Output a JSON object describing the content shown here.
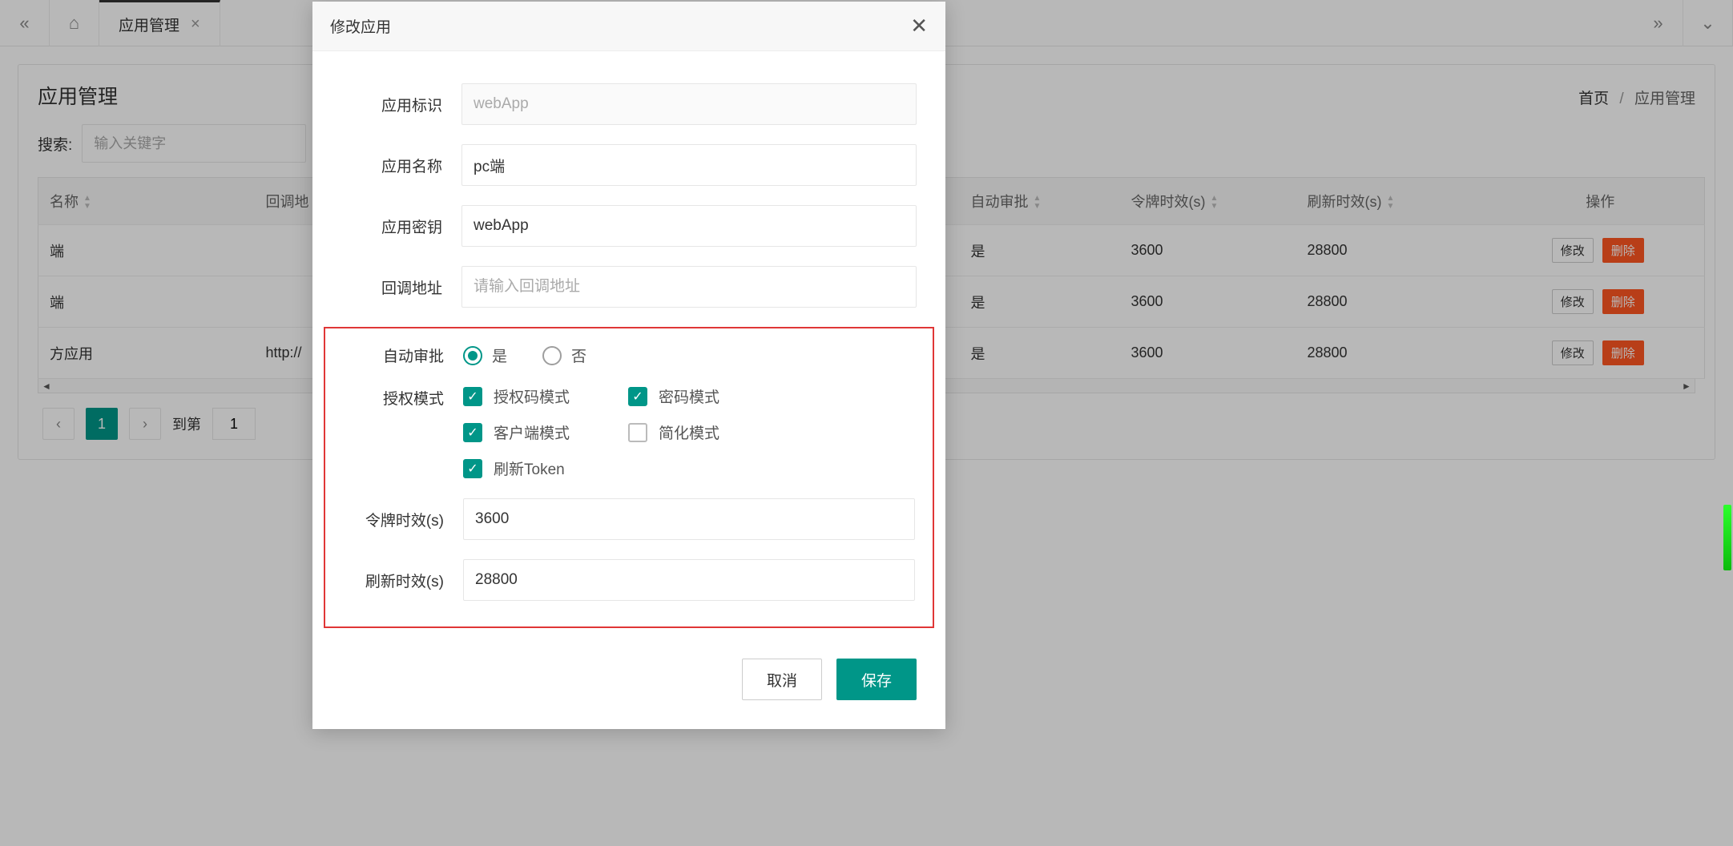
{
  "topbar": {
    "tab_label": "应用管理"
  },
  "page": {
    "title": "应用管理",
    "breadcrumb_home": "首页",
    "breadcrumb_current": "应用管理",
    "search_label": "搜索:",
    "search_placeholder": "输入关键字"
  },
  "table": {
    "headers": {
      "name": "名称",
      "callback": "回调地",
      "auto_approve": "自动审批",
      "token_ttl": "令牌时效(s)",
      "refresh_ttl": "刷新时效(s)",
      "ops": "操作"
    },
    "rows": [
      {
        "name": "端",
        "callback": "",
        "auto": "是",
        "token": "3600",
        "refresh": "28800"
      },
      {
        "name": "端",
        "callback": "",
        "auto": "是",
        "token": "3600",
        "refresh": "28800"
      },
      {
        "name": "方应用",
        "callback": "http://",
        "auto": "是",
        "token": "3600",
        "refresh": "28800"
      }
    ],
    "row_edit_label": "修改",
    "row_delete_label": "删除"
  },
  "pagination": {
    "current": "1",
    "jump_label": "到第",
    "jump_value": "1"
  },
  "modal": {
    "title": "修改应用",
    "labels": {
      "app_id": "应用标识",
      "app_name": "应用名称",
      "app_secret": "应用密钥",
      "callback": "回调地址",
      "auto_approve": "自动审批",
      "auth_modes": "授权模式",
      "token_ttl": "令牌时效(s)",
      "refresh_ttl": "刷新时效(s)"
    },
    "values": {
      "app_id": "webApp",
      "app_name": "pc端",
      "app_secret": "webApp",
      "callback_placeholder": "请输入回调地址",
      "token_ttl": "3600",
      "refresh_ttl": "28800"
    },
    "auto_approve": {
      "yes": "是",
      "no": "否"
    },
    "auth_modes": {
      "code": "授权码模式",
      "password": "密码模式",
      "client": "客户端模式",
      "implicit": "简化模式",
      "refresh": "刷新Token"
    },
    "actions": {
      "cancel": "取消",
      "save": "保存"
    }
  }
}
